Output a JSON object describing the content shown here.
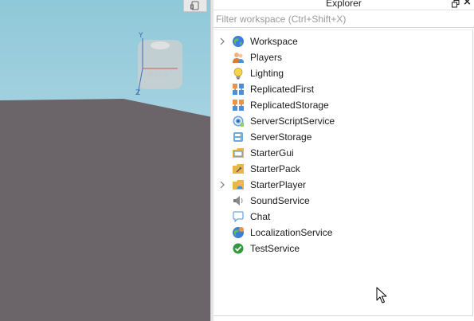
{
  "viewport": {
    "sky_color": "#a6d3e1",
    "ground_color": "#6b6468",
    "view_cube": {
      "face_label": "Back",
      "axis_y": "Y",
      "axis_z": "Z"
    },
    "device_button_icon": "device-emulator-icon"
  },
  "explorer": {
    "title": "Explorer",
    "restore_icon": "restore-window-icon",
    "close_label": "×",
    "filter_placeholder": "Filter workspace (Ctrl+Shift+X)",
    "items": [
      {
        "label": "Workspace",
        "icon": "workspace-globe-icon",
        "expandable": true
      },
      {
        "label": "Players",
        "icon": "players-icon",
        "expandable": false
      },
      {
        "label": "Lighting",
        "icon": "lightbulb-icon",
        "expandable": false
      },
      {
        "label": "ReplicatedFirst",
        "icon": "replicated-first-icon",
        "expandable": false
      },
      {
        "label": "ReplicatedStorage",
        "icon": "replicated-storage-icon",
        "expandable": false
      },
      {
        "label": "ServerScriptService",
        "icon": "server-script-service-icon",
        "expandable": false
      },
      {
        "label": "ServerStorage",
        "icon": "server-storage-icon",
        "expandable": false
      },
      {
        "label": "StarterGui",
        "icon": "starter-gui-icon",
        "expandable": false
      },
      {
        "label": "StarterPack",
        "icon": "starter-pack-icon",
        "expandable": false
      },
      {
        "label": "StarterPlayer",
        "icon": "starter-player-icon",
        "expandable": true
      },
      {
        "label": "SoundService",
        "icon": "speaker-icon",
        "expandable": false
      },
      {
        "label": "Chat",
        "icon": "chat-bubble-icon",
        "expandable": false
      },
      {
        "label": "LocalizationService",
        "icon": "localization-globe-icon",
        "expandable": false
      },
      {
        "label": "TestService",
        "icon": "check-circle-icon",
        "expandable": false
      }
    ]
  }
}
